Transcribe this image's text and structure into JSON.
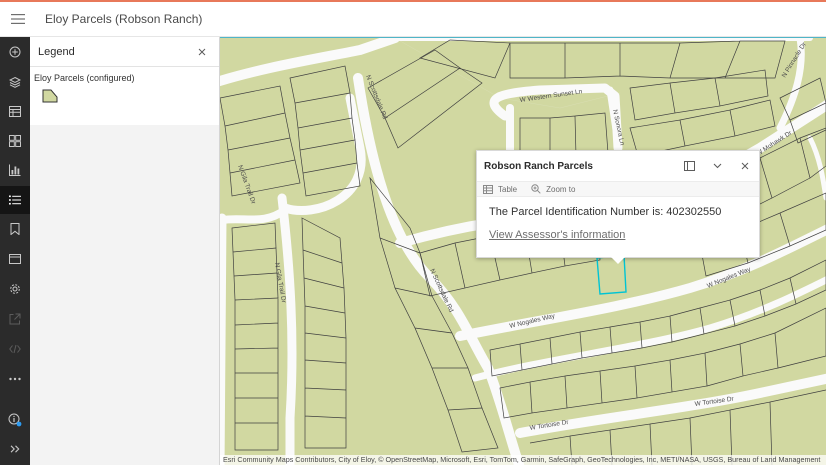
{
  "app": {
    "title": "Eloy Parcels (Robson Ranch)",
    "accent_color": "#e8795a",
    "selection_color": "#00c4d4"
  },
  "action_bar": {
    "items": [
      {
        "name": "add-icon"
      },
      {
        "name": "layers-icon"
      },
      {
        "name": "table-icon"
      },
      {
        "name": "gallery-icon"
      },
      {
        "name": "chart-icon"
      },
      {
        "name": "legend-icon",
        "active": true
      },
      {
        "name": "bookmark-icon"
      },
      {
        "name": "basemap-icon"
      },
      {
        "name": "settings-icon"
      },
      {
        "name": "share-icon"
      },
      {
        "name": "embed-icon"
      },
      {
        "name": "more-icon"
      },
      {
        "name": "info-icon"
      },
      {
        "name": "expand-icon"
      }
    ]
  },
  "legend": {
    "title": "Legend",
    "layer_name": "Eloy Parcels (configured)"
  },
  "map": {
    "roads": [
      "W Western Sunset Ln",
      "N Sonora Ln",
      "N Scottsdale Rd",
      "N Gila Trail Dr",
      "W Mohawk Dr",
      "W Nogales Way",
      "W Tortoise Dr",
      "N Pinnacle Dr"
    ],
    "attribution": "Esri Community Maps Contributors, City of Eloy, © OpenStreetMap, Microsoft, Esri, TomTom, Garmin, SafeGraph, GeoTechnologies, Inc, METI/NASA, USGS, Bureau of Land Management"
  },
  "popup": {
    "title": "Robson Ranch Parcels",
    "tools": {
      "table": "Table",
      "zoom": "Zoom to"
    },
    "text": "The Parcel Identification Number is: 402302550",
    "link": "View Assessor's information"
  }
}
